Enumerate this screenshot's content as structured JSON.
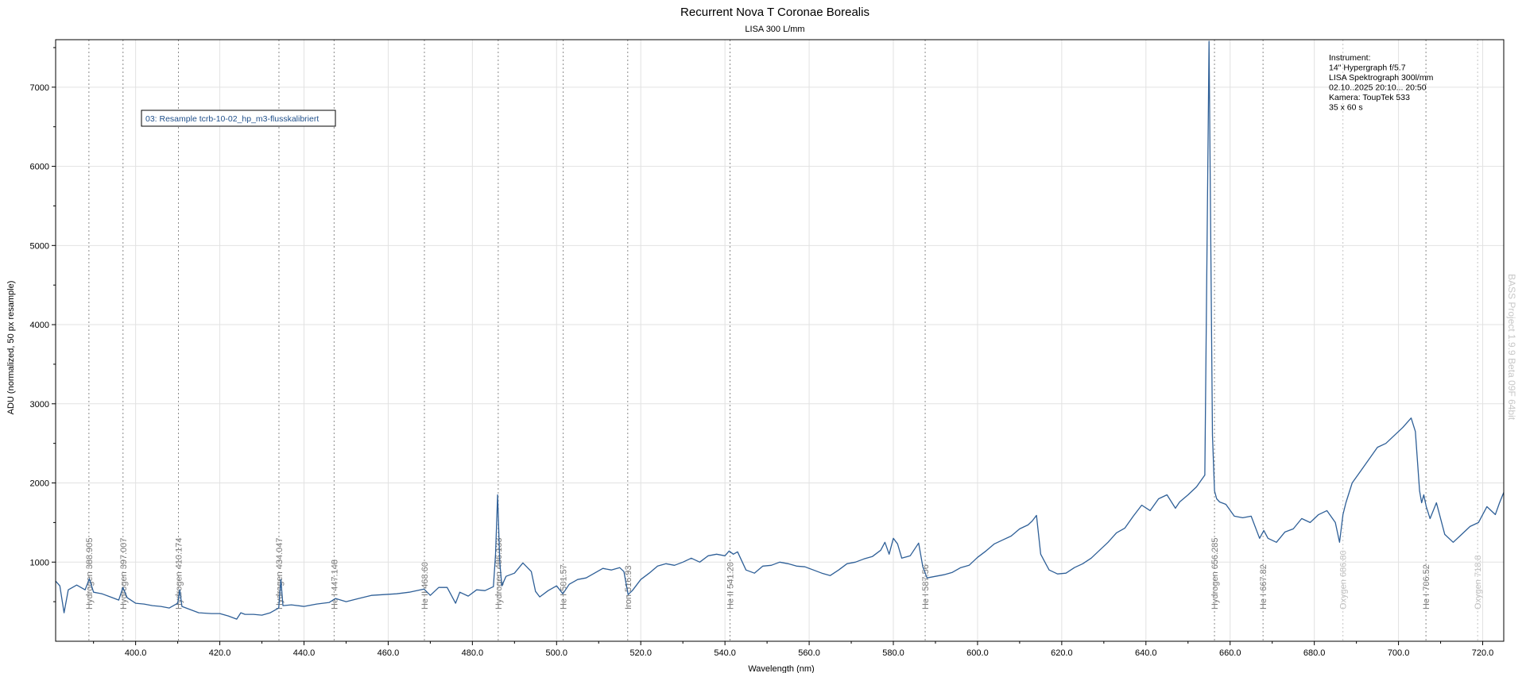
{
  "chart_data": {
    "type": "line",
    "title": "Recurrent Nova T Coronae Borealis",
    "subtitle": "LISA 300 L/mm",
    "xlabel": "Wavelength (nm)",
    "ylabel": "ADU (normalized, 50 px resample)",
    "xlim": [
      381,
      725
    ],
    "ylim": [
      0,
      7600
    ],
    "xticks": [
      "400.0",
      "420.0",
      "440.0",
      "460.0",
      "480.0",
      "500.0",
      "520.0",
      "540.0",
      "560.0",
      "580.0",
      "600.0",
      "620.0",
      "640.0",
      "660.0",
      "680.0",
      "700.0",
      "720.0"
    ],
    "yticks": [
      "1000",
      "2000",
      "3000",
      "4000",
      "5000",
      "6000",
      "7000"
    ],
    "grid": true,
    "legend_label": "03: Resample tcrb-10-02_hp_m3-flusskalibriert",
    "legend_position": "top-left",
    "instrument_text": [
      "Instrument:",
      "14\" Hypergraph f/5.7",
      "LISA Spektrograph 300l/mm",
      "02.10..2025  20:10... 20:50",
      "Kamera: ToupTek 533",
      "35 x 60 s"
    ],
    "watermark": "BASS Project 1.9.9 Beta 09F 64bit",
    "line_color": "#2e5f97",
    "lines": [
      {
        "x": 388.905,
        "label": "Hydrogen 388.905",
        "faded": false
      },
      {
        "x": 397.007,
        "label": "Hydrogen 397.007",
        "faded": false
      },
      {
        "x": 410.174,
        "label": "Hydrogen 410.174",
        "faded": false
      },
      {
        "x": 434.047,
        "label": "Hydrogen 434.047",
        "faded": false
      },
      {
        "x": 447.148,
        "label": "He I 447.148",
        "faded": false
      },
      {
        "x": 468.6,
        "label": "He II 468.60",
        "faded": false
      },
      {
        "x": 486.133,
        "label": "Hydrogen 486.133",
        "faded": false
      },
      {
        "x": 501.57,
        "label": "He I 501.57",
        "faded": false
      },
      {
        "x": 516.9,
        "label": "Iron 516.93",
        "faded": false
      },
      {
        "x": 541.2,
        "label": "He II 541.20",
        "faded": false
      },
      {
        "x": 587.56,
        "label": "He I 587.56",
        "faded": false
      },
      {
        "x": 656.285,
        "label": "Hydrogen 656.285",
        "faded": false
      },
      {
        "x": 667.82,
        "label": "He I 667.82",
        "faded": false
      },
      {
        "x": 686.8,
        "label": "Oxygen 686.80",
        "faded": true
      },
      {
        "x": 706.52,
        "label": "He I 706.52",
        "faded": false
      },
      {
        "x": 718.8,
        "label": "Oxygen 718.8",
        "faded": true
      }
    ],
    "series": [
      {
        "x": [
          381,
          382,
          383,
          384,
          386,
          388,
          389,
          390,
          392,
          394,
          396,
          397,
          398,
          400,
          402,
          404,
          406,
          408,
          410,
          410.5,
          411,
          413,
          415,
          418,
          420,
          422,
          424,
          425,
          426,
          428,
          430,
          432,
          434,
          434.5,
          435,
          437,
          440,
          443,
          446,
          447.5,
          450,
          453,
          456,
          459,
          462,
          465,
          468.5,
          470,
          472,
          474,
          476,
          477,
          479,
          481,
          483,
          485,
          485.5,
          486,
          486.5,
          487,
          488,
          490,
          492,
          494,
          495,
          496,
          498,
          500,
          501.5,
          503,
          505,
          507,
          509,
          511,
          513,
          515,
          516,
          517,
          518,
          520,
          522,
          524,
          526,
          528,
          530,
          532,
          534,
          536,
          538,
          540,
          541,
          542,
          543,
          545,
          547,
          549,
          551,
          553,
          555,
          557,
          559,
          561,
          563,
          565,
          567,
          569,
          571,
          573,
          575,
          577,
          578,
          579,
          580,
          581,
          582,
          584,
          586,
          587,
          588,
          590,
          592,
          594,
          596,
          598,
          600,
          602,
          604,
          606,
          608,
          610,
          612,
          613,
          614,
          615,
          616,
          617,
          619,
          621,
          623,
          625,
          627,
          629,
          631,
          633,
          635,
          637,
          639,
          641,
          643,
          645,
          647,
          648,
          650,
          652,
          654,
          655,
          655.8,
          656.3,
          656.8,
          657.5,
          659,
          661,
          663,
          665,
          667,
          668,
          669,
          671,
          673,
          675,
          677,
          679,
          681,
          683,
          685,
          686,
          686.8,
          687.5,
          689,
          691,
          693,
          695,
          697,
          699,
          701,
          703,
          704,
          705,
          705.5,
          706,
          706.6,
          707.5,
          709,
          711,
          713,
          715,
          717,
          719,
          721,
          723,
          724,
          725
        ],
        "y": [
          760,
          700,
          360,
          650,
          710,
          650,
          790,
          620,
          600,
          560,
          520,
          680,
          550,
          480,
          470,
          450,
          440,
          420,
          480,
          650,
          440,
          400,
          360,
          350,
          350,
          320,
          280,
          360,
          340,
          340,
          330,
          360,
          420,
          780,
          450,
          460,
          440,
          470,
          490,
          540,
          500,
          540,
          580,
          590,
          600,
          620,
          660,
          580,
          680,
          680,
          480,
          620,
          570,
          650,
          640,
          690,
          1100,
          1850,
          1000,
          700,
          820,
          860,
          990,
          880,
          630,
          560,
          640,
          700,
          600,
          720,
          780,
          800,
          860,
          920,
          900,
          930,
          880,
          590,
          640,
          780,
          860,
          950,
          980,
          960,
          1000,
          1050,
          1000,
          1080,
          1100,
          1080,
          1140,
          1100,
          1130,
          900,
          860,
          950,
          960,
          1000,
          980,
          950,
          940,
          900,
          860,
          830,
          900,
          980,
          1000,
          1040,
          1070,
          1150,
          1250,
          1100,
          1300,
          1230,
          1050,
          1080,
          1240,
          940,
          800,
          820,
          840,
          870,
          930,
          960,
          1060,
          1140,
          1230,
          1280,
          1330,
          1420,
          1470,
          1520,
          1590,
          1100,
          1000,
          900,
          850,
          860,
          930,
          980,
          1050,
          1150,
          1250,
          1370,
          1430,
          1580,
          1720,
          1650,
          1800,
          1850,
          1680,
          1760,
          1850,
          1950,
          2100,
          7580,
          2600,
          1900,
          1800,
          1760,
          1730,
          1580,
          1560,
          1580,
          1300,
          1400,
          1300,
          1250,
          1380,
          1420,
          1550,
          1500,
          1600,
          1650,
          1500,
          1250,
          1600,
          1750,
          2000,
          2150,
          2300,
          2450,
          2500,
          2600,
          2700,
          2820,
          2650,
          1900,
          1750,
          1850,
          1700,
          1550,
          1750,
          1350,
          1250,
          1350,
          1450,
          1500,
          1700,
          1600,
          1750,
          1880
        ]
      }
    ]
  }
}
